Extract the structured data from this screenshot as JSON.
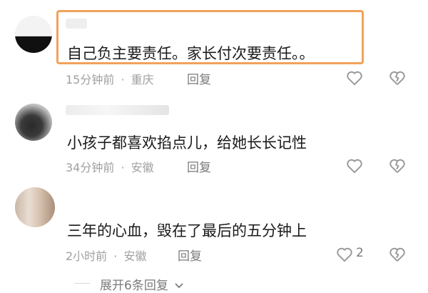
{
  "comments": [
    {
      "text": "自己负主要责任。家长付次要责任。。",
      "time": "15分钟前",
      "location": "重庆",
      "reply_label": "回复",
      "likes": "",
      "highlighted": true
    },
    {
      "text": "小孩子都喜欢掐点儿，给她长长记性",
      "time": "34分钟前",
      "location": "安徽",
      "reply_label": "回复",
      "likes": ""
    },
    {
      "text": "三年的心血，毁在了最后的五分钟上",
      "time": "2小时前",
      "location": "安徽",
      "reply_label": "回复",
      "likes": "2"
    }
  ],
  "meta_separator": "·",
  "expand_label": "展开6条回复",
  "colors": {
    "highlight_border": "#f2a25b",
    "meta_text": "#a0a0a0",
    "icon_gray": "#9a9a9a"
  },
  "icons": [
    "heart-outline-icon",
    "broken-heart-icon",
    "chevron-down-icon"
  ]
}
